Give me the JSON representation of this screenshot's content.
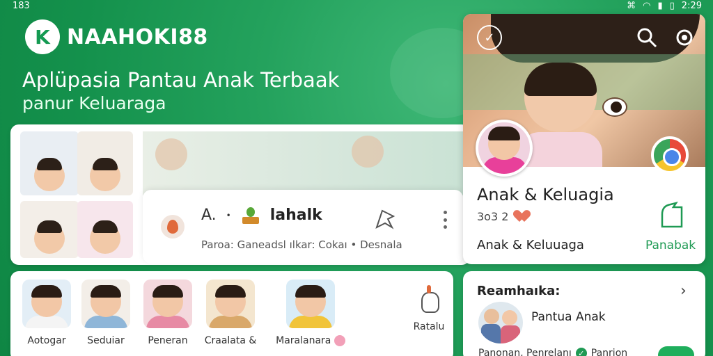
{
  "status": {
    "left": "183",
    "time": "2:29"
  },
  "brand": {
    "logo_letter": "K",
    "name": "NAAHOKI88"
  },
  "hero": {
    "headline": "Aplüpasia Pantau Anak Terbaak",
    "subline": "panur Keluaraga"
  },
  "feed": {
    "title_prefix": "A.",
    "title_mid": "•",
    "title_strong": "lahalk",
    "meta": "Paroa: Ganeadsl ılkar: Cokaı  •  Desnala"
  },
  "profile": {
    "name": "Anak & Keluagia",
    "stats": "3o3 2",
    "family": "Anak & Keluuaga",
    "action": "Panabak"
  },
  "categories": [
    {
      "label": "Aotogar",
      "bg": "#e3eef6",
      "body": "#f4f4f4"
    },
    {
      "label": "Seduiar",
      "bg": "#f3eee8",
      "body": "#8fb6d8"
    },
    {
      "label": "Peneran",
      "bg": "#f4d8dd",
      "body": "#e78aa4"
    },
    {
      "label": "Craalata &",
      "bg": "#f4e6cf",
      "body": "#d9a86a"
    },
    {
      "label": "Maralanara",
      "bg": "#d9ecf7",
      "body": "#f1c43a"
    }
  ],
  "categories_more": {
    "label": "Ratalu"
  },
  "reminder": {
    "title": "Reamhaıka:",
    "item": "Pantua Anak",
    "row_a": "Panonan, Penrelanı",
    "row_b": "Panrion"
  },
  "colors": {
    "brand_green": "#1a9a55",
    "accent": "#1f9a54",
    "badge": "#e06a3b"
  }
}
